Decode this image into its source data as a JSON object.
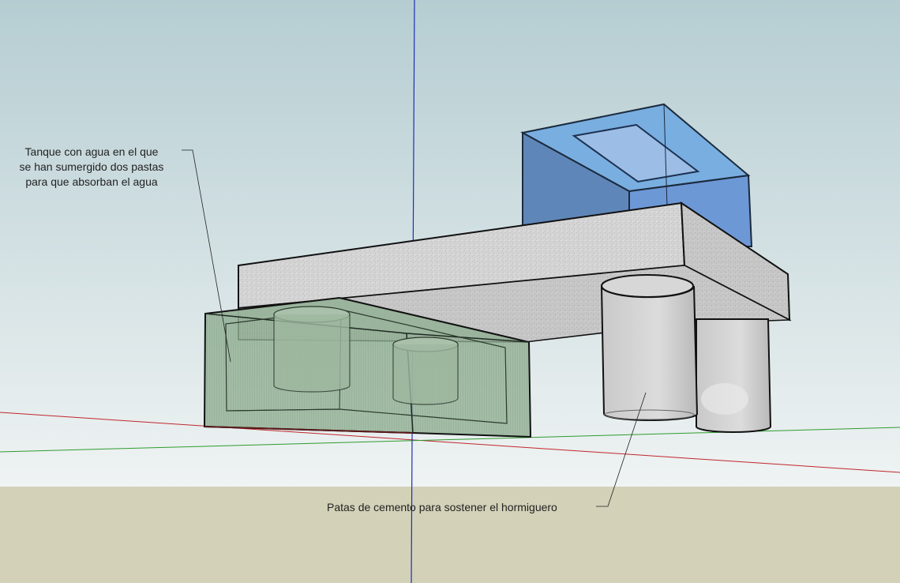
{
  "annotations": {
    "tank": {
      "lines": [
        "Tanque  con  agua en el que",
        "se han sumergido dos pastas",
        "para  que  absorban  el agua"
      ]
    },
    "legs": {
      "text": "Patas de cemento para sostener el hormiguero"
    }
  },
  "colors": {
    "sky_top": "#b7cfd3",
    "sky_bottom": "#eef2f2",
    "ground": "#d3d1b8",
    "axis_blue": "#1f2fb4",
    "axis_red": "#c0272d",
    "axis_green": "#2f9b2f",
    "concrete": "#d2d2d2",
    "water_tank": "#8aa88c",
    "blue_box": "#6f9ad3"
  }
}
